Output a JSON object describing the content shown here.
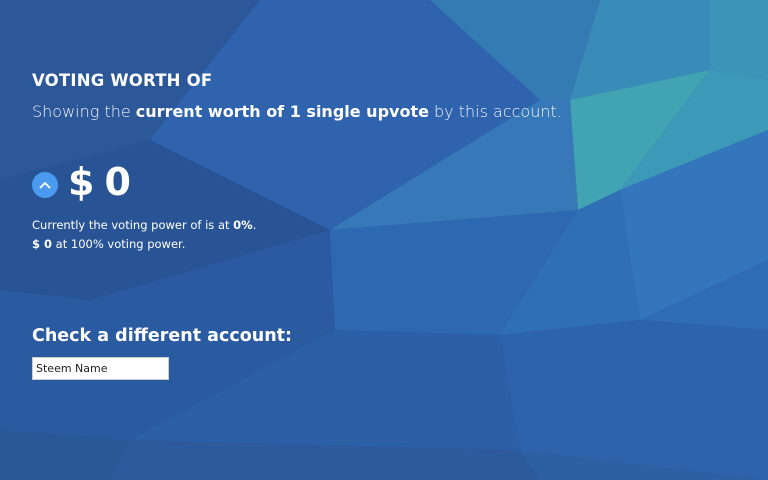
{
  "header": {
    "title": "VOTING WORTH OF",
    "subtitle_prefix": "Showing the ",
    "subtitle_bold": "current worth of 1 single upvote",
    "subtitle_suffix": " by this account."
  },
  "worth": {
    "currency": "$",
    "amount": "0",
    "upvote_icon": "chevron-up-icon",
    "upvote_color": "#4a9bf0"
  },
  "info": {
    "line1_prefix": "Currently the voting power of  is at ",
    "line1_power": "0%",
    "line1_suffix": ".",
    "line2_value": "$ 0",
    "line2_suffix": " at 100% voting power."
  },
  "check": {
    "title": "Check a different account:",
    "input_value": "",
    "input_placeholder": "Steem Name"
  },
  "colors": {
    "background": "#2a5ba3",
    "accent_teal": "#3fa6b4",
    "text": "#ffffff"
  }
}
